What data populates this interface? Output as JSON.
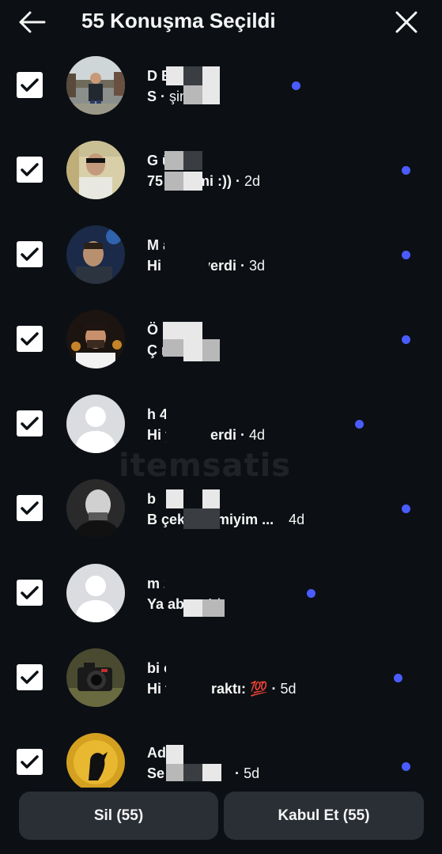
{
  "header": {
    "title": "55 Konuşma Seçildi"
  },
  "conversations": [
    {
      "name": "D       BEY",
      "message": "S         ",
      "time": "şimdi",
      "unread": true
    },
    {
      "name": "G          üner",
      "message": "75          er dimi :))",
      "time": "2d",
      "unread": true
    },
    {
      "name": "M          ayfur",
      "message": "Hi          yanıt verdi",
      "time": "3d",
      "unread": true
    },
    {
      "name": "Ö          ",
      "message": "Ç           m",
      "time": "3d",
      "unread": true
    },
    {
      "name": "h          4",
      "message": "Hi          yanıt verdi",
      "time": "4d",
      "unread": true
    },
    {
      "name": "b",
      "message": "B           çekmez miyim ...",
      "time": "4d",
      "unread": true
    },
    {
      "name": "m          24237",
      "message": "Ya          aba",
      "time": "4d",
      "unread": true
    },
    {
      "name": "bi         oto",
      "message": "Hi          fade bıraktı: 💯",
      "time": "5d",
      "unread": true
    },
    {
      "name": "Ad",
      "message": "Se",
      "time": "5d",
      "unread": true
    }
  ],
  "actions": {
    "delete_label": "Sil (55)",
    "accept_label": "Kabul Et (55)"
  },
  "colors": {
    "background": "#0c1014",
    "unread_dot": "#4a5cff",
    "button": "#2a2f36"
  }
}
